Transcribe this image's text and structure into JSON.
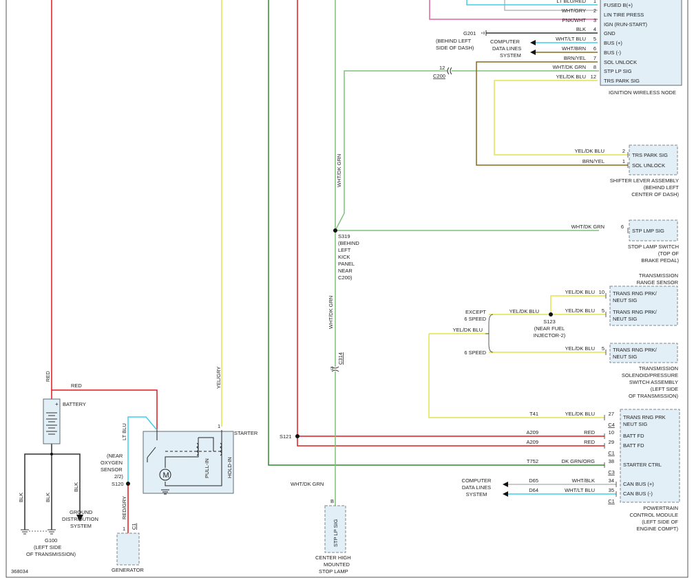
{
  "diagram_id": "368034",
  "colors": {
    "red": "#e0191c",
    "yellow": "#e3e34a",
    "green": "#7ec07a",
    "dkgreen": "#2c8a2c",
    "cyan": "#3cd0e8",
    "brown": "#8a6a1a",
    "pink": "#e060a0",
    "black": "#303030",
    "gray": "#b8b8b8",
    "component_fill": "#e3eff6"
  },
  "ignition_node": {
    "title": "IGNITION WIRELESS NODE",
    "pins": [
      {
        "num": "1",
        "wire": "LT BLU/RED",
        "label": "FUSED B(+)"
      },
      {
        "num": "2",
        "wire": "WHT/GRY",
        "label": "LIN TIRE PRESS"
      },
      {
        "num": "3",
        "wire": "PNK/WHT",
        "label": "IGN (RUN-START)"
      },
      {
        "num": "4",
        "wire": "BLK",
        "label": "GND"
      },
      {
        "num": "5",
        "wire": "WHT/LT BLU",
        "label": "BUS (+)"
      },
      {
        "num": "6",
        "wire": "WHT/BRN",
        "label": "BUS (-)"
      },
      {
        "num": "7",
        "wire": "BRN/YEL",
        "label": "SOL UNLOCK"
      },
      {
        "num": "8",
        "wire": "WHT/DK GRN",
        "label": "STP LP SIG"
      },
      {
        "num": "12",
        "wire": "YEL/DK BLU",
        "label": "TRS PARK SIG"
      }
    ]
  },
  "g201": {
    "label": "G201",
    "note": [
      "(BEHIND LEFT",
      "SIDE OF DASH)"
    ]
  },
  "computer_data_lines_top": [
    "COMPUTER",
    "DATA LINES",
    "SYSTEM"
  ],
  "c200": {
    "pin": "12",
    "label": "C200"
  },
  "shifter": {
    "title": [
      "SHIFTER LEVER ASSEMBLY",
      "(BEHIND LEFT",
      "CENTER OF DASH)"
    ],
    "pins": [
      {
        "num": "2",
        "wire": "YEL/DK BLU",
        "label": "TRS PARK SIG"
      },
      {
        "num": "1",
        "wire": "BRN/YEL",
        "label": "SOL UNLOCK"
      }
    ]
  },
  "stop_lamp_switch": {
    "title": [
      "STOP LAMP SWITCH",
      "(TOP OF",
      "BRAKE PEDAL)"
    ],
    "pin": {
      "num": "6",
      "wire": "WHT/DK GRN",
      "label": "STP LMP SIG"
    }
  },
  "s319": {
    "label": [
      "S319",
      "(BEHIND",
      "LEFT",
      "KICK",
      "PANEL",
      "NEAR",
      "C200)"
    ]
  },
  "green_wire_label": "WHT/DK GRN",
  "trs": {
    "title": [
      "TRANSMISSION",
      "RANGE SENSOR"
    ],
    "pins": [
      {
        "num": "10",
        "wire": "YEL/DK BLU",
        "label": [
          "TRANS RNG PRK/",
          "NEUT SIG"
        ]
      },
      {
        "num": "5",
        "wire": "YEL/DK BLU",
        "label": [
          "TRANS RNG PRK/",
          "NEUT SIG"
        ]
      }
    ]
  },
  "except_6_speed": [
    "EXCEPT",
    "6 SPEED"
  ],
  "s123": {
    "wire": "YEL/DK BLU",
    "label": [
      "S123",
      "(NEAR FUEL",
      "INJECTOR-2)"
    ]
  },
  "six_speed": "6 SPEED",
  "yel_dk_blu": "YEL/DK BLU",
  "solenoid": {
    "title": [
      "TRANSMISSION",
      "SOLENOID/PRESSURE",
      "SWITCH ASSEMBLY",
      "(LEFT SIDE",
      "OF TRANSMISSION)"
    ],
    "pin": {
      "num": "5",
      "wire": "YEL/DK BLU",
      "label": [
        "TRANS RNG PRK/",
        "NEUT SIG"
      ]
    }
  },
  "c314": {
    "pin": "5",
    "label": "C314"
  },
  "pcm": {
    "title": [
      "POWERTRAIN",
      "CONTROL MODULE",
      "(LEFT SIDE OF",
      "ENGINE COMPT)"
    ],
    "rows": [
      {
        "circuit": "T41",
        "wire": "YEL/DK BLU",
        "num": "27",
        "label": [
          "TRANS RNG PRK",
          "NEUT SIG"
        ],
        "conn": "C4"
      },
      {
        "circuit": "A209",
        "wire": "RED",
        "num": "10",
        "label": [
          "BATT FD"
        ],
        "conn": ""
      },
      {
        "circuit": "A209",
        "wire": "RED",
        "num": "29",
        "label": [
          "BATT FD"
        ],
        "conn": "C1"
      },
      {
        "circuit": "T752",
        "wire": "DK GRN/ORG",
        "num": "38",
        "label": [
          "STARTER CTRL"
        ],
        "conn": "C3"
      },
      {
        "circuit": "D65",
        "wire": "WHT/BLK",
        "num": "34",
        "label": [
          "CAN BUS (+)"
        ],
        "conn": ""
      },
      {
        "circuit": "D64",
        "wire": "WHT/LT BLU",
        "num": "35",
        "label": [
          "CAN BUS (-)"
        ],
        "conn": "C1"
      }
    ]
  },
  "s121": "S121",
  "computer_data_lines_bottom": [
    "COMPUTER",
    "DATA LINES",
    "SYSTEM"
  ],
  "battery": {
    "label": "BATTERY",
    "wire_red_top": "RED",
    "wire_red_h": "RED",
    "ground_wires": [
      "BLK",
      "BLK",
      "BLK"
    ],
    "ground_dist": [
      "GROUND",
      "DISTRIBUTION",
      "SYSTEM"
    ],
    "g100": [
      "G100",
      "(LEFT SIDE",
      "OF TRANSMISSION)"
    ]
  },
  "starter": {
    "label": "STARTER",
    "pin": "1",
    "wire": "YEL/GRY",
    "pull_in": "PULL-IN",
    "hold_in": "HOLD-IN",
    "motor": "M"
  },
  "s120": {
    "label": "S120",
    "note": [
      "(NEAR",
      "OXYGEN",
      "SENSOR",
      "2/2)"
    ],
    "wire_top": "LT BLU",
    "wire_bottom": "RED/GRY"
  },
  "generator": {
    "label": "GENERATOR",
    "pin": "1",
    "conn": "C1"
  },
  "chmsl": {
    "wire": "WHT/DK GRN",
    "pin": "B",
    "label": "STP LP SIG",
    "title": [
      "CENTER HIGH",
      "MOUNTED",
      "STOP LAMP"
    ]
  }
}
